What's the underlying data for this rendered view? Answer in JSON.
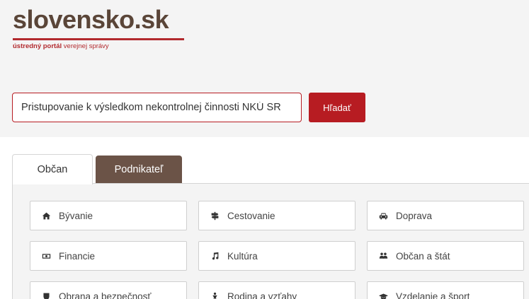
{
  "logo": {
    "main": "slovensko.sk",
    "sub_bold": "ústredný portál",
    "sub_rest": "verejnej správy"
  },
  "search": {
    "value": "Pristupovanie k výsledkom nekontrolnej činnosti NKÚ SR",
    "button_label": "Hľadať"
  },
  "tabs": [
    {
      "label": "Občan",
      "active": true
    },
    {
      "label": "Podnikateľ",
      "active": false
    }
  ],
  "categories": [
    {
      "label": "Bývanie",
      "icon": "home-icon"
    },
    {
      "label": "Cestovanie",
      "icon": "signpost-icon"
    },
    {
      "label": "Doprava",
      "icon": "car-icon"
    },
    {
      "label": "Financie",
      "icon": "money-icon"
    },
    {
      "label": "Kultúra",
      "icon": "music-icon"
    },
    {
      "label": "Občan a štát",
      "icon": "people-icon"
    },
    {
      "label": "Obrana a bezpečnosť",
      "icon": "shield-icon"
    },
    {
      "label": "Rodina a vzťahy",
      "icon": "child-icon"
    },
    {
      "label": "Vzdelanie a šport",
      "icon": "graduation-cap-icon"
    }
  ],
  "colors": {
    "brand_red": "#b71c22",
    "brand_brown": "#6b5347"
  }
}
